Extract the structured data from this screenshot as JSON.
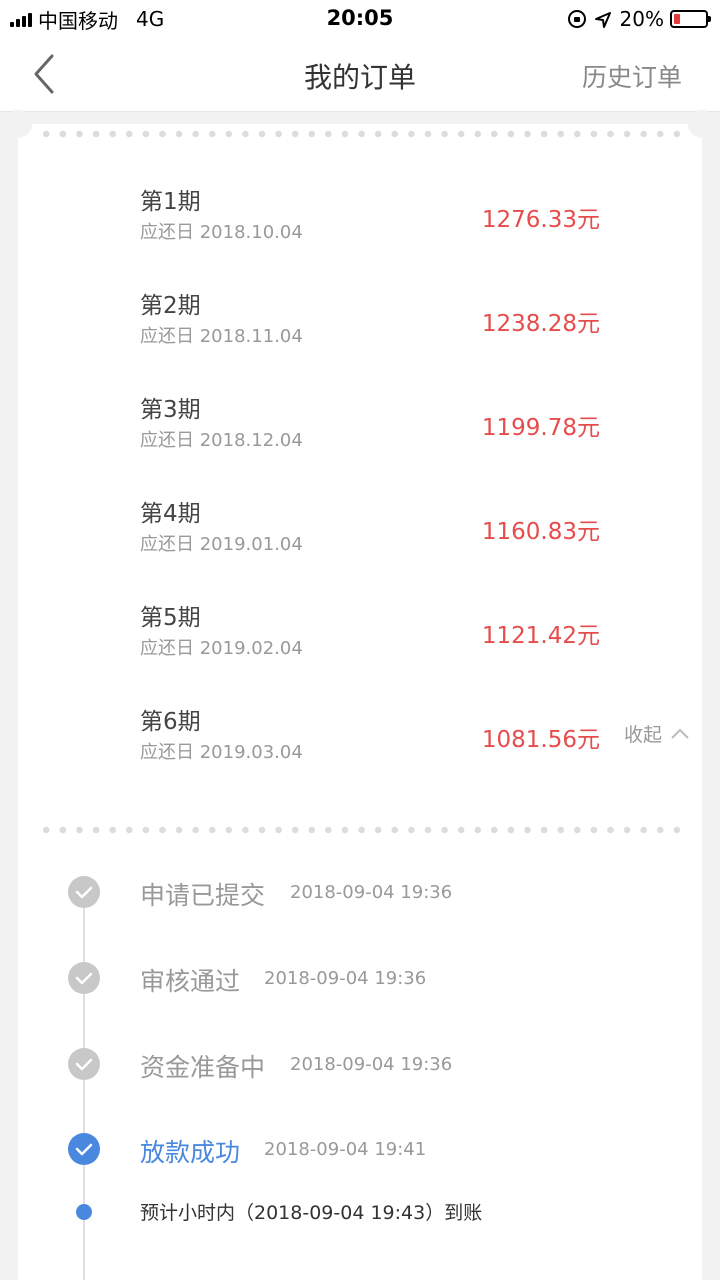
{
  "status_bar": {
    "carrier": "中国移动",
    "network": "4G",
    "time": "20:05",
    "battery": "20%",
    "battery_level": 0.2
  },
  "nav": {
    "title": "我的订单",
    "history": "历史订单"
  },
  "periods": [
    {
      "label": "第1期",
      "date": "应还日 2018.10.04",
      "amount": "1276.33元"
    },
    {
      "label": "第2期",
      "date": "应还日 2018.11.04",
      "amount": "1238.28元"
    },
    {
      "label": "第3期",
      "date": "应还日 2018.12.04",
      "amount": "1199.78元"
    },
    {
      "label": "第4期",
      "date": "应还日 2019.01.04",
      "amount": "1160.83元"
    },
    {
      "label": "第5期",
      "date": "应还日 2019.02.04",
      "amount": "1121.42元"
    },
    {
      "label": "第6期",
      "date": "应还日 2019.03.04",
      "amount": "1081.56元"
    }
  ],
  "collapse_label": "收起",
  "timeline": [
    {
      "title": "申请已提交",
      "time": "2018-09-04 19:36"
    },
    {
      "title": "审核通过",
      "time": "2018-09-04 19:36"
    },
    {
      "title": "资金准备中",
      "time": "2018-09-04 19:36"
    },
    {
      "title": "放款成功",
      "time": "2018-09-04 19:41"
    }
  ],
  "timeline_note": "预计小时内（2018-09-04 19:43）到账",
  "colors": {
    "amount": "#e64c4c",
    "active": "#4a88e0",
    "inactive": "#c8c8c8"
  }
}
